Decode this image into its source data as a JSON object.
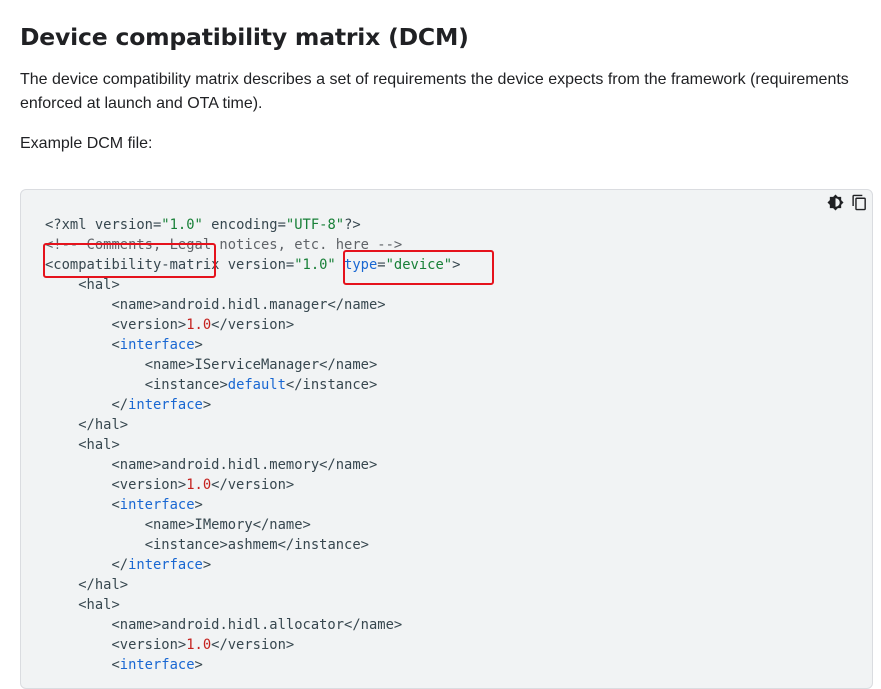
{
  "heading": "Device compatibility matrix (DCM)",
  "description": "The device compatibility matrix describes a set of requirements the device expects from the framework (requirements enforced at launch and OTA time).",
  "example_label": "Example DCM file:",
  "code_tools": {
    "theme_icon": "brightness-icon",
    "copy_icon": "copy-icon"
  },
  "code": {
    "l1a": "<?xml version=",
    "l1b": "\"1.0\"",
    "l1c": " encoding=",
    "l1d": "\"UTF-8\"",
    "l1e": "?>",
    "l2": "<!-- Comments, Legal notices, etc. here -->",
    "l3a": "<compatibility-matrix version=",
    "l3b": "\"1.0\"",
    "l3c": " ",
    "l3d": "type",
    "l3e": "=",
    "l3f": "\"device\"",
    "l3g": ">",
    "hal_open": "<hal>",
    "hal_close": "</hal>",
    "name_open": "<name>",
    "name_close": "</name>",
    "version_open": "<version>",
    "version_close": "</version>",
    "version_value": "1.0",
    "interface_open_a": "<",
    "interface_word": "interface",
    "interface_open_b": ">",
    "interface_close_a": "</",
    "instance_open": "<instance>",
    "instance_close": "</instance>",
    "hal1_name": "android.hidl.manager",
    "hal1_iface_name": "IServiceManager",
    "hal1_instance": "default",
    "hal2_name": "android.hidl.memory",
    "hal2_iface_name": "IMemory",
    "hal2_instance": "ashmem",
    "hal3_name": "android.hidl.allocator"
  },
  "highlight_color": "#e5121c"
}
